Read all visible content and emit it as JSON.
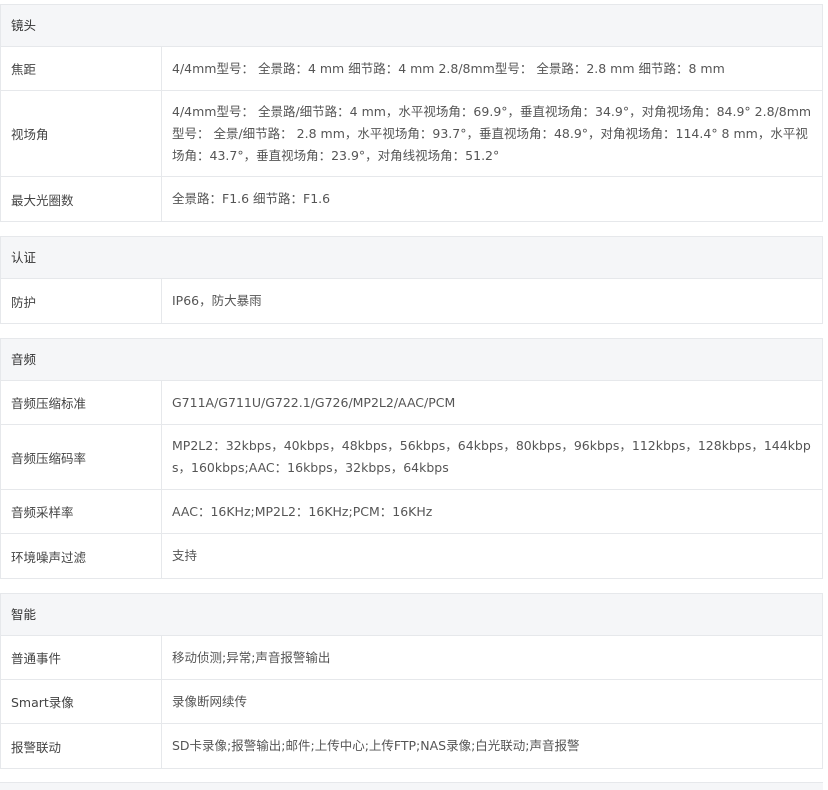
{
  "sections": [
    {
      "title": "镜头",
      "rows": [
        {
          "label": "焦距",
          "value": "4/4mm型号： 全景路：4 mm 细节路：4 mm 2.8/8mm型号： 全景路：2.8 mm 细节路：8 mm"
        },
        {
          "label": "视场角",
          "value": "4/4mm型号： 全景路/细节路：4 mm，水平视场角：69.9°，垂直视场角：34.9°，对角视场角：84.9° 2.8/8mm型号： 全景/细节路： 2.8 mm，水平视场角：93.7°，垂直视场角：48.9°，对角视场角：114.4° 8 mm，水平视场角：43.7°，垂直视场角：23.9°，对角线视场角：51.2°"
        },
        {
          "label": "最大光圈数",
          "value": "全景路：F1.6 细节路：F1.6"
        }
      ]
    },
    {
      "title": "认证",
      "rows": [
        {
          "label": "防护",
          "value": "IP66，防大暴雨"
        }
      ]
    },
    {
      "title": "音频",
      "rows": [
        {
          "label": "音频压缩标准",
          "value": "G711A/G711U/G722.1/G726/MP2L2/AAC/PCM"
        },
        {
          "label": "音频压缩码率",
          "value": "MP2L2：32kbps，40kbps，48kbps，56kbps，64kbps，80kbps，96kbps，112kbps，128kbps，144kbps，160kbps;AAC：16kbps，32kbps，64kbps"
        },
        {
          "label": "音频采样率",
          "value": "AAC：16KHz;MP2L2：16KHz;PCM：16KHz"
        },
        {
          "label": "环境噪声过滤",
          "value": "支持"
        }
      ]
    },
    {
      "title": "智能",
      "rows": [
        {
          "label": "普通事件",
          "value": "移动侦测;异常;声音报警输出"
        },
        {
          "label": "Smart录像",
          "value": "录像断网续传"
        },
        {
          "label": "报警联动",
          "value": "SD卡录像;报警输出;邮件;上传中心;上传FTP;NAS录像;白光联动;声音报警"
        }
      ]
    }
  ]
}
